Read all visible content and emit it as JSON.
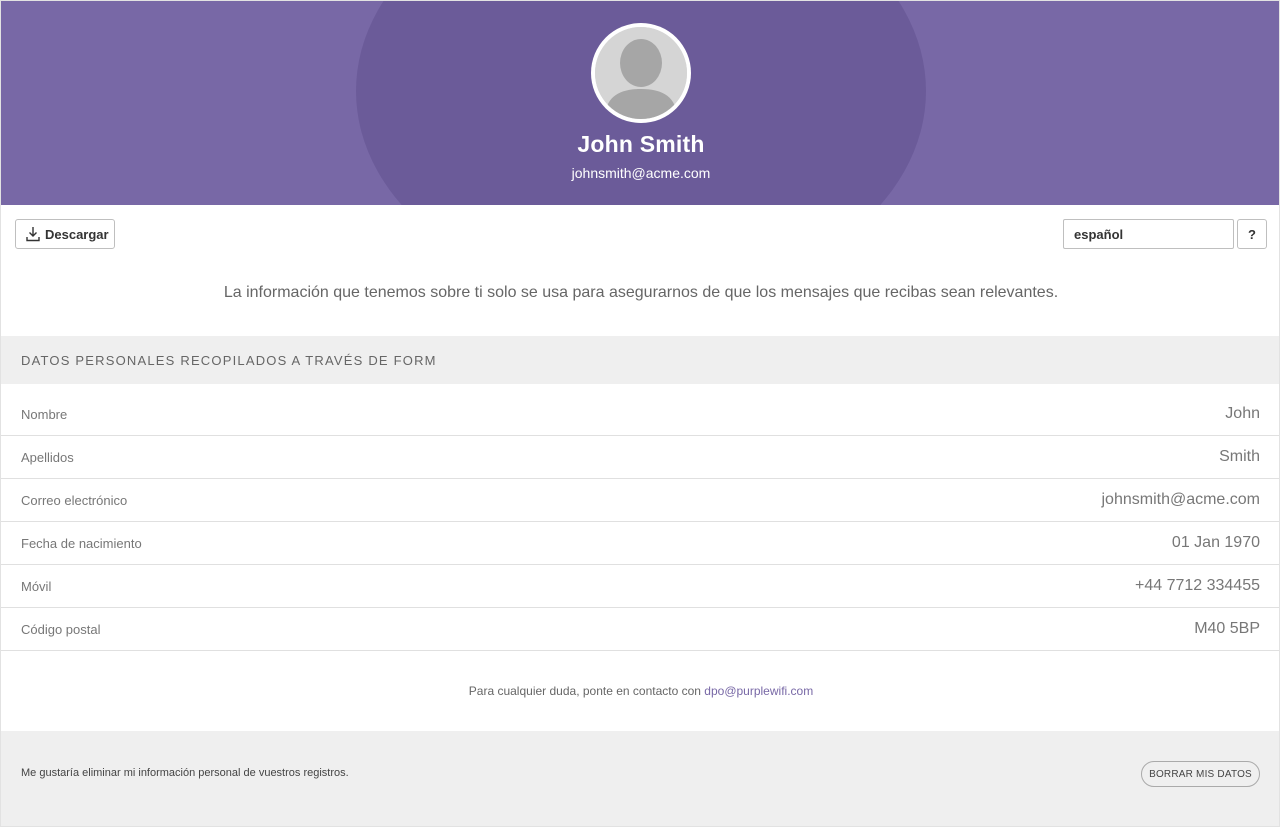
{
  "profile": {
    "name": "John Smith",
    "email": "johnsmith@acme.com"
  },
  "toolbar": {
    "download_label": "Descargar",
    "language": "español",
    "help_label": "?"
  },
  "intro_text": "La información que tenemos sobre ti solo se usa para asegurarnos de que los mensajes que recibas sean relevantes.",
  "section": {
    "title": "DATOS PERSONALES RECOPILADOS A TRAVÉS DE FORM",
    "rows": [
      {
        "label": "Nombre",
        "value": "John"
      },
      {
        "label": "Apellidos",
        "value": "Smith"
      },
      {
        "label": "Correo electrónico",
        "value": "johnsmith@acme.com"
      },
      {
        "label": "Fecha de nacimiento",
        "value": "01 Jan 1970"
      },
      {
        "label": "Móvil",
        "value": "+44 7712 334455"
      },
      {
        "label": "Código postal",
        "value": "M40 5BP"
      }
    ]
  },
  "contact": {
    "text": "Para cualquier duda, ponte en contacto con",
    "email": "dpo@purplewifi.com"
  },
  "footer": {
    "message": "Me gustaría eliminar mi información personal de vuestros registros.",
    "delete_label": "BORRAR MIS DATOS"
  },
  "colors": {
    "header": "#7868a6",
    "header_dark": "#6b5b99",
    "link": "#7868a6",
    "section_bg": "#efefef"
  }
}
